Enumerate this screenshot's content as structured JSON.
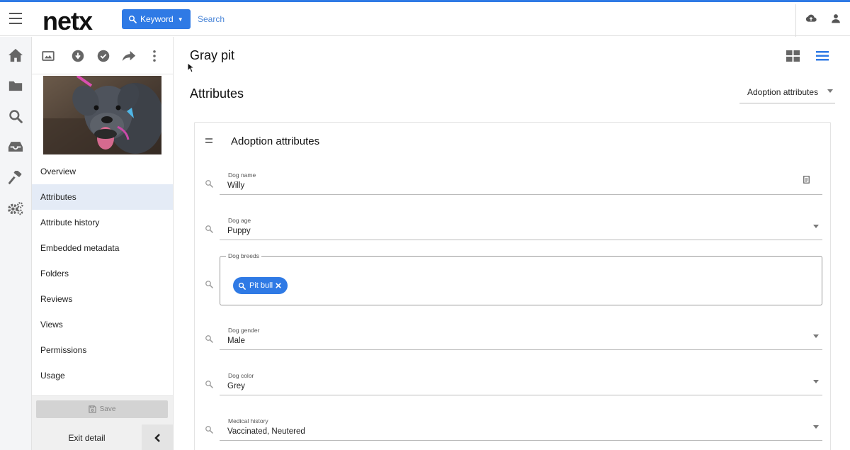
{
  "colors": {
    "accent": "#2f7ae5",
    "active_nav_bg": "#e4ebf6"
  },
  "header": {
    "logo": "netx",
    "keyword_label": "Keyword",
    "search_placeholder": "Search"
  },
  "rail": [
    "home-icon",
    "folder-icon",
    "search-icon",
    "inbox-icon",
    "hammer-icon",
    "settings-icon"
  ],
  "panel": {
    "tools": [
      "image-icon",
      "download-icon",
      "check-circle-icon",
      "share-icon",
      "more-vert-icon"
    ],
    "nav": [
      {
        "label": "Overview",
        "active": false
      },
      {
        "label": "Attributes",
        "active": true
      },
      {
        "label": "Attribute history",
        "active": false
      },
      {
        "label": "Embedded metadata",
        "active": false
      },
      {
        "label": "Folders",
        "active": false
      },
      {
        "label": "Reviews",
        "active": false
      },
      {
        "label": "Views",
        "active": false
      },
      {
        "label": "Permissions",
        "active": false
      },
      {
        "label": "Usage",
        "active": false
      }
    ],
    "save_label": "Save",
    "exit_label": "Exit detail"
  },
  "main": {
    "asset_title": "Gray pit",
    "section_title": "Attributes",
    "attribute_set": "Adoption attributes",
    "card_title": "Adoption attributes",
    "fields": {
      "dog_name": {
        "label": "Dog name",
        "value": "Willy"
      },
      "dog_age": {
        "label": "Dog age",
        "value": "Puppy"
      },
      "dog_breeds": {
        "label": "Dog breeds",
        "chips": [
          "Pit bull"
        ]
      },
      "dog_gender": {
        "label": "Dog gender",
        "value": "Male"
      },
      "dog_color": {
        "label": "Dog color",
        "value": "Grey"
      },
      "medical_history": {
        "label": "Medical history",
        "value": "Vaccinated, Neutered"
      }
    }
  }
}
